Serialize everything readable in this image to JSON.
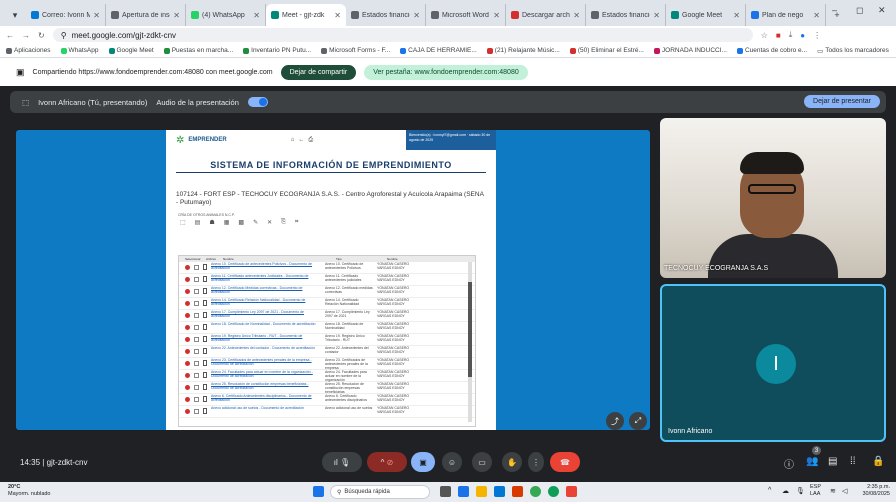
{
  "browser": {
    "tabs": [
      {
        "label": "Correo: Ivonn Mo",
        "color": "#0078d4"
      },
      {
        "label": "Apertura de inscr",
        "color": "#5f6368"
      },
      {
        "label": "(4) WhatsApp",
        "color": "#25d366"
      },
      {
        "label": "Meet - gjt-zdk",
        "color": "#00897b",
        "active": true
      },
      {
        "label": "Estados financier",
        "color": "#5f6368"
      },
      {
        "label": "Microsoft Word -",
        "color": "#5f6368"
      },
      {
        "label": "Descargar archiv",
        "color": "#d32f2f"
      },
      {
        "label": "Estados financier",
        "color": "#5f6368"
      },
      {
        "label": "Google Meet",
        "color": "#00897b"
      },
      {
        "label": "Plan de nego",
        "color": "#1a73e8"
      }
    ],
    "new_tab": "+",
    "url": "meet.google.com/gjt-zdkt-cnv",
    "bookmarks": [
      {
        "label": "Aplicaciones",
        "color": "#5f6368"
      },
      {
        "label": "WhatsApp",
        "color": "#25d366"
      },
      {
        "label": "Google Meet",
        "color": "#00897b"
      },
      {
        "label": "Puestas en marcha...",
        "color": "#1e8e3e"
      },
      {
        "label": "Inventario PN Putu...",
        "color": "#1e8e3e"
      },
      {
        "label": "Microsoft Forms - F...",
        "color": "#5f6368"
      },
      {
        "label": "CAJA DE HERRAMIE...",
        "color": "#1a73e8"
      },
      {
        "label": "(21) Relajante Músic...",
        "color": "#d32f2f"
      },
      {
        "label": "(50) Eliminar el Estré...",
        "color": "#d32f2f"
      },
      {
        "label": "JORNADA INDUCCI...",
        "color": "#c2185b"
      },
      {
        "label": "Cuentas de cobro e...",
        "color": "#1a73e8"
      }
    ],
    "all_bookmarks": "Todos los marcadores"
  },
  "share_bar": {
    "message": "Compartiendo https://www.fondoemprender.com:48080 con meet.google.com",
    "stop_label": "Dejar de compartir",
    "switch_label": "Ver pestaña: www.fondoemprender.com:48080"
  },
  "presentation": {
    "presenter": "Ivonn Africano (Tú, presentando)",
    "audio_label": "Audio de la presentación",
    "stop_label": "Dejar de presentar"
  },
  "shared_doc": {
    "logo": "EMPRENDER",
    "welcome": "Bienvenido(a) : ivonnyl7@gmail.com · sábado 30 de agosto de 2025",
    "title": "SISTEMA DE INFORMACIÓN DE EMPRENDIMIENTO",
    "subtitle": "107124 - FORT ESP - TECHOCUY ECOGRANJA S.A.S. - Centro Agroforestal y Acuícola Arapaima (SENA - Putumayo)",
    "small": "CRÍA DE OTROS ANIMALES N.C.P.",
    "columns": [
      "Seleccionar",
      "Archivo",
      "Nombre",
      "Tipo",
      "Nombre"
    ],
    "rows": [
      {
        "name": "Anexo 10. Certificado de antecedentes Policivos - Documento de acreditación",
        "tipo": "Anexo 10. Certificado de antecedentes Policivos",
        "nombre": "YONATAN CASERO VARGAS EDNOY"
      },
      {
        "name": "Anexo 11. Certificado antecedentes Judiciales - Documento de acreditación",
        "tipo": "Anexo 11. Certificado antecedentes judiciales",
        "nombre": "YONATAN CASERO VARGAS EDNOY"
      },
      {
        "name": "Anexo 12. Certificado Medidas correctivas - Documento de acreditación",
        "tipo": "Anexo 12. Certificado medidas correctivas",
        "nombre": "YONATAN CASERO VARGAS EDNOY"
      },
      {
        "name": "Anexo 14. Certificado Relación Nationalidad - Documento de acreditación",
        "tipo": "Anexo 14. Certificado Relación Nationalidad",
        "nombre": "YONATAN CASERO VARGAS EDNOY"
      },
      {
        "name": "Anexo 17. Cumplimiento Ley 2097 de 2021 - Documento de acreditación",
        "tipo": "Anexo 17. Cumplimiento Ley 2097 de 2021",
        "nombre": "YONATAN CASERO VARGAS EDNOY"
      },
      {
        "name": "Anexo 18. Certificado de Nominalidad - Documento de acreditación",
        "tipo": "Anexo 18. Certificado de Nominalidad",
        "nombre": "YONATAN CASERO VARGAS EDNOY"
      },
      {
        "name": "Anexo 19. Registro Único Tributario - RUT - Documento de acreditación",
        "tipo": "Anexo 19. Registro Único Tributario - RUT",
        "nombre": "YONATAN CASERO VARGAS EDNOY"
      },
      {
        "name": "Anexo 22. Antecedentes del contador - Documento de acreditación",
        "tipo": "Anexo 22. Antecedentes del contador",
        "nombre": "YONATAN CASERO VARGAS EDNOY"
      },
      {
        "name": "Anexo 23. Certificados de antecedentes penales de la empresa - Documento de acreditación",
        "tipo": "Anexo 23. Certificados de antecedentes penales de la empresa",
        "nombre": "YONATAN CASERO VARGAS EDNOY"
      },
      {
        "name": "Anexo 24. Facultades para actuar en nombre de la organización - Documento de acreditación",
        "tipo": "Anexo 24. Facultades para actuar en nombre de la organización",
        "nombre": "YONATAN CASERO VARGAS EDNOY"
      },
      {
        "name": "Anexo 25. Resolución de constitución empresas beneficiarias - Documento de acreditación",
        "tipo": "Anexo 25. Resolución de constitución empresas beneficiarias",
        "nombre": "YONATAN CASERO VARGAS EDNOY"
      },
      {
        "name": "Anexo 6. Certificado Antecedentes disciplinarios - Documento de acreditación",
        "tipo": "Anexo 6. Certificado antecedentes disciplinarios",
        "nombre": "YONATAN CASERO VARGAS EDNOY"
      },
      {
        "name": "Anexo adicional uso de suelos - Documento de acreditación",
        "tipo": "Anexo adicional uso de suelos",
        "nombre": "YONATAN CASERO VARGAS EDNOY"
      }
    ]
  },
  "participants": [
    {
      "name": "TECNOCUY ECOGRANJA S.A.S"
    },
    {
      "name": "Ivonn Africano",
      "initial": "I"
    }
  ],
  "meeting": {
    "time": "14:35",
    "code": "gjt-zdkt-cnv",
    "participant_count": "3"
  },
  "taskbar": {
    "weather_temp": "20°C",
    "weather_desc": "Mayorm. nublado",
    "search_placeholder": "Búsqueda rápida",
    "lang": "ESP",
    "lang2": "LAA",
    "clock_time": "2:35 p.m.",
    "clock_date": "30/08/2025"
  }
}
